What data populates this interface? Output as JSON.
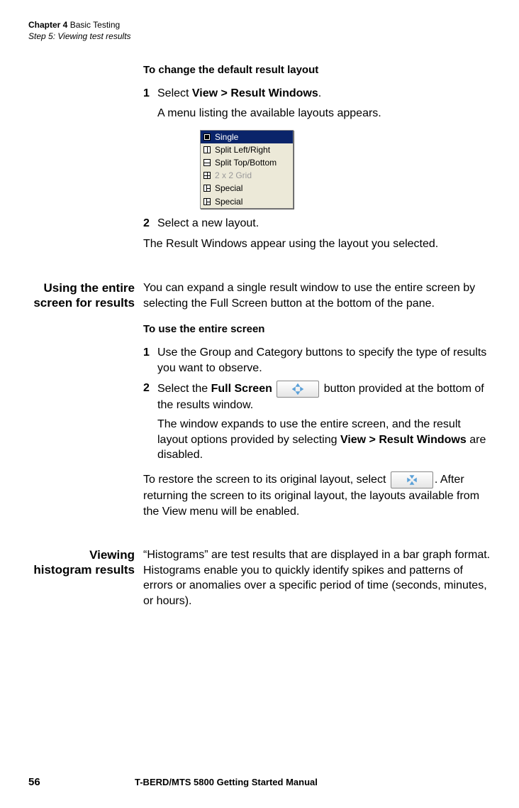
{
  "header": {
    "chapter_label": "Chapter 4",
    "chapter_title": "Basic Testing",
    "step_line": "Step 5: Viewing test results"
  },
  "section1": {
    "subhead": "To change the default result layout",
    "step1_text_prefix": "Select ",
    "step1_bold": "View > Result Windows",
    "step1_suffix": ".",
    "step1_result": "A menu listing the available layouts appears.",
    "menu_items": [
      {
        "label": "Single",
        "icon": "single",
        "selected": true
      },
      {
        "label": "Split Left/Right",
        "icon": "split-lr"
      },
      {
        "label": "Split Top/Bottom",
        "icon": "split-tb"
      },
      {
        "label": "2 x 2 Grid",
        "icon": "grid",
        "disabled": true
      },
      {
        "label": "Special",
        "icon": "special"
      },
      {
        "label": "Special",
        "icon": "special"
      }
    ],
    "step2_text": "Select a new layout.",
    "closing": "The Result Windows appear using the layout you selected."
  },
  "section2": {
    "label": "Using the entire screen for results",
    "intro": "You can expand a single result window to use the entire screen by selecting the Full Screen button at the bottom of the pane.",
    "subhead": "To use the entire screen",
    "step1": "Use the Group and Category buttons to specify the type of results you want to observe.",
    "step2_prefix": "Select the ",
    "step2_bold": "Full Screen",
    "step2_suffix": " button provided at the bottom of the results window.",
    "step2_result_a": "The window expands to use the entire screen, and the result layout options provided by selecting ",
    "step2_result_bold": "View > Result Windows",
    "step2_result_b": " are disabled.",
    "restore_a": "To restore the screen to its original layout, select ",
    "restore_b": ". After returning the screen to its original layout, the layouts available from the View menu will be enabled."
  },
  "section3": {
    "label": "Viewing histogram results",
    "body": "“Histograms” are test results that are displayed in a bar graph format. Histograms enable you to quickly identify spikes and patterns of errors or anomalies over a specific period of time (seconds, minutes, or hours)."
  },
  "footer": {
    "page": "56",
    "manual": "T-BERD/MTS 5800 Getting Started Manual"
  },
  "icons": {
    "fullscreen": "fullscreen-expand-icon",
    "restore": "fullscreen-collapse-icon"
  }
}
